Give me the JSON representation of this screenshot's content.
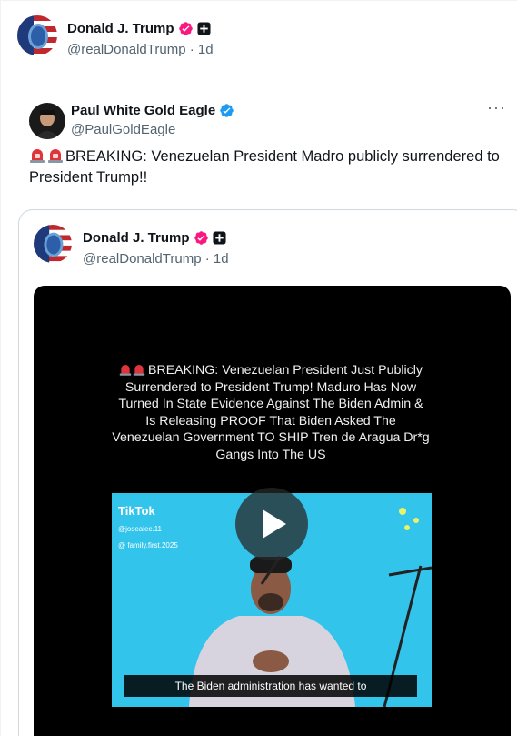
{
  "main_tweet": {
    "name": "Donald J. Trump",
    "handle": "@realDonaldTrump",
    "time": "1d"
  },
  "quoted_tweet": {
    "name": "Paul White Gold Eagle",
    "handle": "@PaulGoldEagle",
    "more": "···",
    "text": "BREAKING: Venezuelan President Madro publicly surrendered to President Trump!!",
    "inner": {
      "name": "Donald J. Trump",
      "handle": "@realDonaldTrump",
      "time": "1d",
      "video": {
        "caption": "BREAKING: Venezuelan President Just Publicly Surrendered to President Trump! Maduro Has Now Turned In State Evidence Against The Biden Admin & Is Releasing PROOF That Biden Asked The Venezuelan Government TO SHIP Tren de Aragua Dr*g Gangs Into The US",
        "tiktok_brand": "TikTok",
        "tiktok_user1": "@josealec.11",
        "tiktok_user2": "@ family.first.2025",
        "subtitle": "The Biden administration has wanted to"
      }
    }
  },
  "colors": {
    "verified_blue": "#1d9bf0",
    "gold_badge": "#f91880",
    "text_primary": "#0f1419",
    "text_secondary": "#536471",
    "video_bg": "#000000",
    "tiktok_bg": "#33c4ec"
  },
  "icons": [
    "verified-check-icon",
    "affiliate-badge-icon",
    "more-options-icon",
    "siren-icon",
    "play-icon"
  ]
}
